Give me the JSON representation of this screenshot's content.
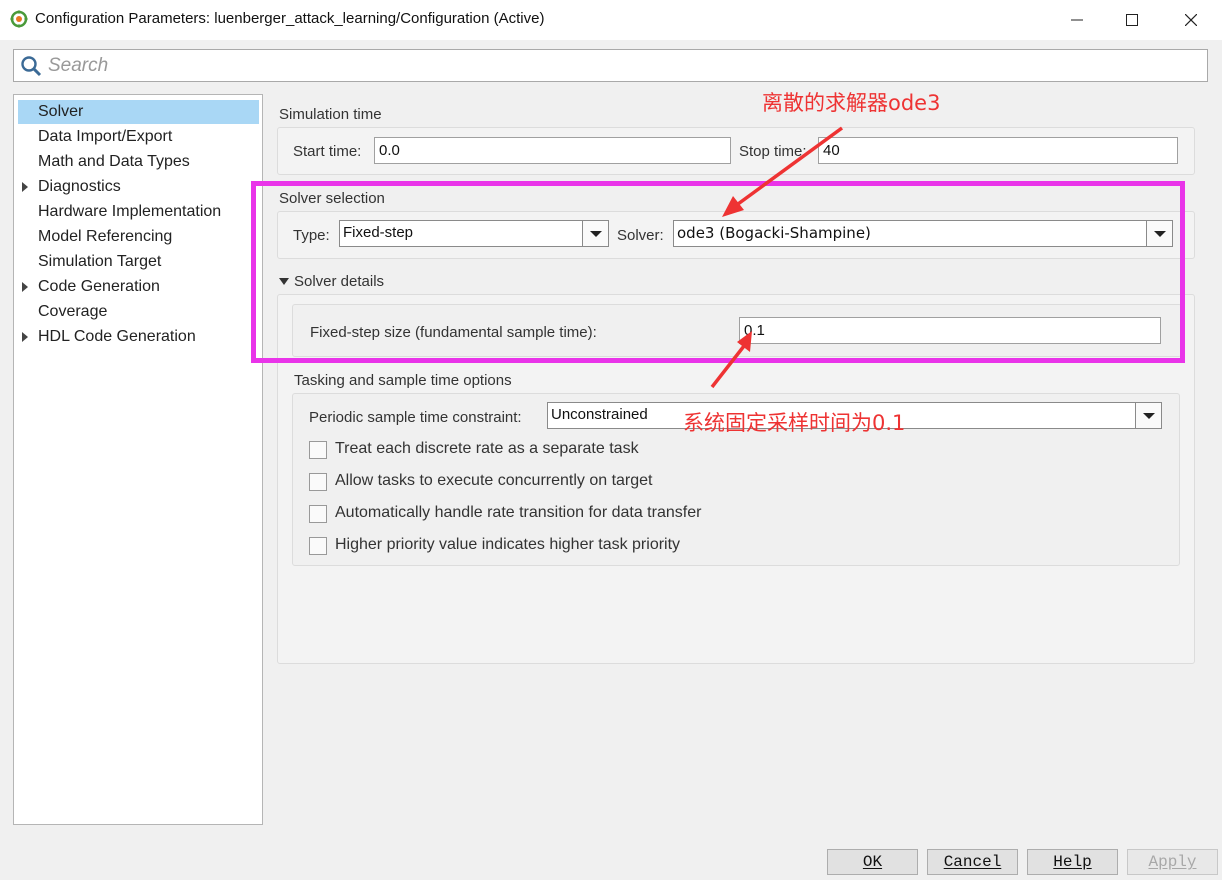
{
  "window": {
    "title": "Configuration Parameters: luenberger_attack_learning/Configuration (Active)",
    "icon": "gear-icon"
  },
  "search": {
    "placeholder": "Search",
    "value": ""
  },
  "nav": {
    "items": [
      {
        "label": "Solver",
        "selected": true,
        "expandable": false
      },
      {
        "label": "Data Import/Export",
        "selected": false,
        "expandable": false
      },
      {
        "label": "Math and Data Types",
        "selected": false,
        "expandable": false
      },
      {
        "label": "Diagnostics",
        "selected": false,
        "expandable": true
      },
      {
        "label": "Hardware Implementation",
        "selected": false,
        "expandable": false
      },
      {
        "label": "Model Referencing",
        "selected": false,
        "expandable": false
      },
      {
        "label": "Simulation Target",
        "selected": false,
        "expandable": false
      },
      {
        "label": "Code Generation",
        "selected": false,
        "expandable": true
      },
      {
        "label": "Coverage",
        "selected": false,
        "expandable": false
      },
      {
        "label": "HDL Code Generation",
        "selected": false,
        "expandable": true
      }
    ]
  },
  "simulation_time": {
    "heading": "Simulation time",
    "start_label": "Start time:",
    "start_value": "0.0",
    "stop_label": "Stop time:",
    "stop_value": "40"
  },
  "solver_selection": {
    "heading": "Solver selection",
    "type_label": "Type:",
    "type_value": "Fixed-step",
    "solver_label": "Solver:",
    "solver_value": "ode3 (Bogacki-Shampine)"
  },
  "solver_details": {
    "heading": "Solver details",
    "step_label": "Fixed-step size (fundamental sample time):",
    "step_value": "0.1"
  },
  "tasking": {
    "heading": "Tasking and sample time options",
    "constraint_label": "Periodic sample time constraint:",
    "constraint_value": "Unconstrained",
    "checkboxes": [
      {
        "label": "Treat each discrete rate as a separate task",
        "checked": false
      },
      {
        "label": "Allow tasks to execute concurrently on target",
        "checked": false
      },
      {
        "label": "Automatically handle rate transition for data transfer",
        "checked": false
      },
      {
        "label": "Higher priority value indicates higher task priority",
        "checked": false
      }
    ]
  },
  "buttons": {
    "ok": "OK",
    "cancel": "Cancel",
    "help": "Help",
    "apply": "Apply",
    "apply_enabled": false
  },
  "annotations": {
    "solver_note": "离散的求解器ode3",
    "step_note": "系统固定采样时间为0.1",
    "color": "#ee3333",
    "frame_color": "#e934e9"
  },
  "colors": {
    "selection": "#a9d7f5",
    "background": "#f0f0f0"
  }
}
